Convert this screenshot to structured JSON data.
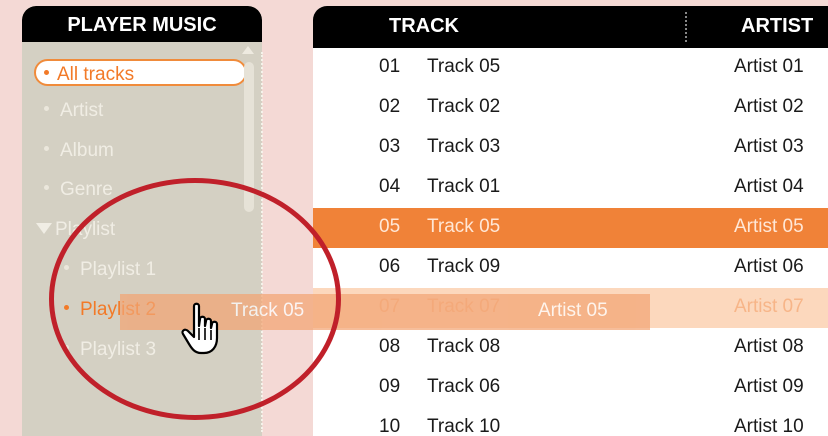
{
  "sidebar": {
    "title": "PLAYER MUSIC",
    "items": [
      {
        "label": "All tracks",
        "state": "selected",
        "icon": "bullet-icon"
      },
      {
        "label": "Artist",
        "icon": "bullet-icon"
      },
      {
        "label": "Album",
        "icon": "bullet-icon"
      },
      {
        "label": "Genre",
        "icon": "bullet-icon"
      },
      {
        "label": "Playlist",
        "icon": "triangle-expanded-icon"
      },
      {
        "label": "Playlist 1",
        "icon": "bullet-icon"
      },
      {
        "label": "Playlist 2",
        "state": "drop-target",
        "icon": "bullet-icon"
      },
      {
        "label": "Playlist 3",
        "icon": "bullet-icon"
      }
    ]
  },
  "table": {
    "columns": [
      "TRACK",
      "ARTIST"
    ],
    "rows": [
      {
        "num": "01",
        "title": "Track 05",
        "artist": "Artist 01"
      },
      {
        "num": "02",
        "title": "Track 02",
        "artist": "Artist 02"
      },
      {
        "num": "03",
        "title": "Track 03",
        "artist": "Artist 03"
      },
      {
        "num": "04",
        "title": "Track 01",
        "artist": "Artist 04"
      },
      {
        "num": "05",
        "title": "Track 05",
        "artist": "Artist 05",
        "state": "selected"
      },
      {
        "num": "06",
        "title": "Track 09",
        "artist": "Artist 06"
      },
      {
        "num": "07",
        "title": "Track 07",
        "artist": "Artist 07",
        "state": "under-drag"
      },
      {
        "num": "08",
        "title": "Track 08",
        "artist": "Artist 08"
      },
      {
        "num": "09",
        "title": "Track 06",
        "artist": "Artist 09"
      },
      {
        "num": "10",
        "title": "Track 10",
        "artist": "Artist 10"
      }
    ]
  },
  "drag_ghost": {
    "title": "Track 05",
    "artist": "Artist 05"
  },
  "colors": {
    "accent": "#f08238",
    "highlight_circle": "#c0202a",
    "page_background": "#f4d9d5",
    "sidebar_background": "#d4d0c3"
  },
  "icons": {
    "pointer": "hand-pointer-icon",
    "scroll_up": "scroll-up-arrow-icon"
  }
}
